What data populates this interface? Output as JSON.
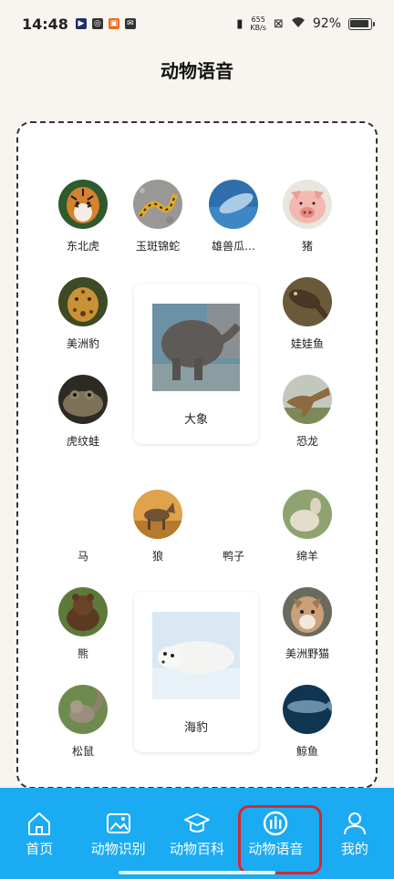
{
  "status": {
    "time": "14:48",
    "speed_top": "655",
    "speed_bottom": "KB/s",
    "battery": "92%"
  },
  "page": {
    "title": "动物语音"
  },
  "animals": {
    "tiger": "东北虎",
    "snake": "玉斑锦蛇",
    "fish": "雄兽瓜…",
    "pig": "猪",
    "jaguar": "美洲豹",
    "salamander": "娃娃鱼",
    "frog": "虎纹蛙",
    "dinosaur": "恐龙",
    "horse": "马",
    "wolf": "狼",
    "duck": "鸭子",
    "sheep": "绵羊",
    "bear": "熊",
    "lynx": "美洲野猫",
    "squirrel": "松鼠",
    "whale": "鲸鱼"
  },
  "cards": {
    "elephant": "大象",
    "seal": "海豹"
  },
  "nav": {
    "home": "首页",
    "recognize": "动物识别",
    "wiki": "动物百科",
    "voice": "动物语音",
    "mine": "我的"
  },
  "colors": {
    "nav_background": "#1aabf3",
    "active_outline": "#d9262e",
    "page_background": "#f8f5f0"
  }
}
